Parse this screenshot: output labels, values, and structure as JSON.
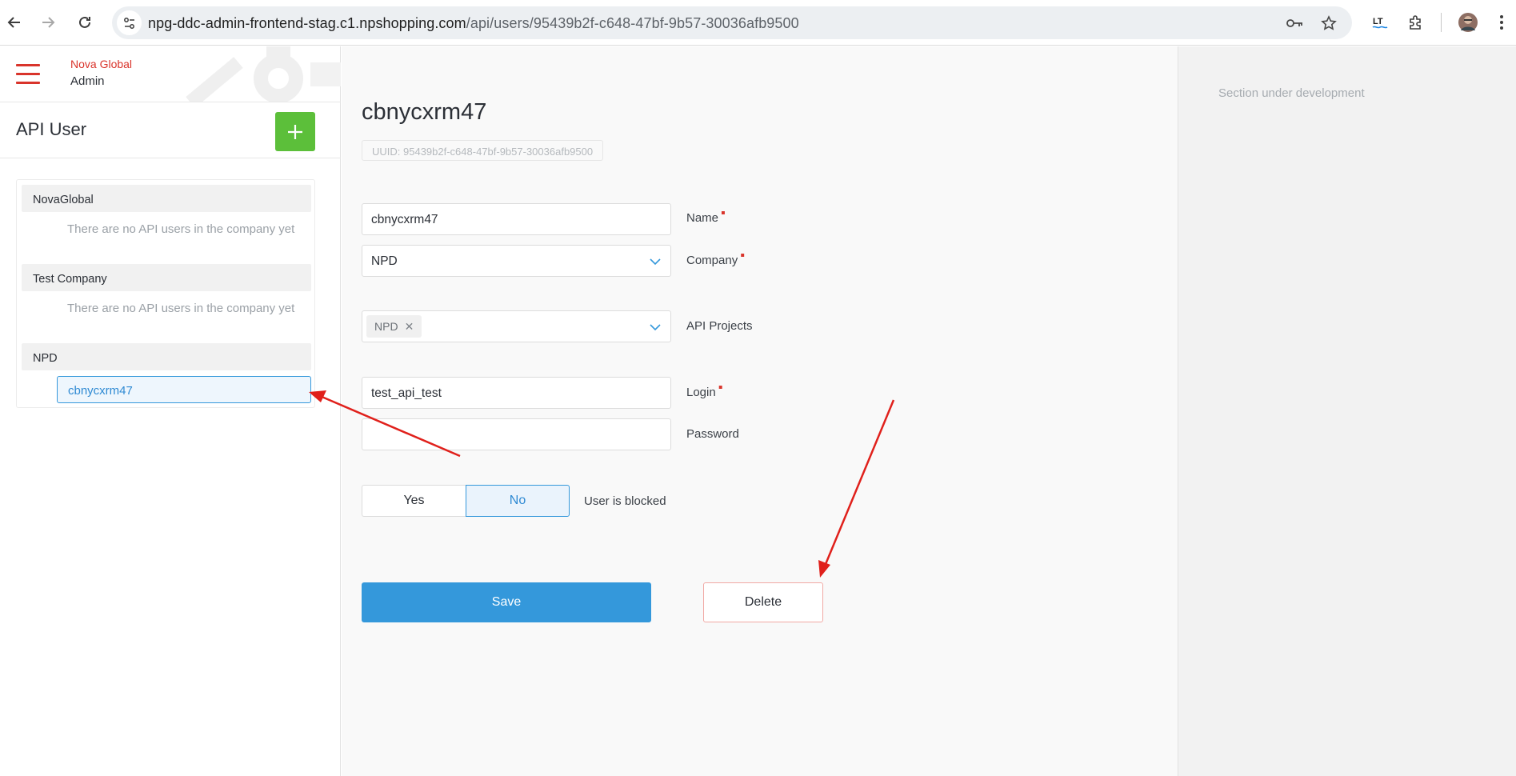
{
  "browser": {
    "url_host": "npg-ddc-admin-frontend-stag.c1.npshopping.com",
    "url_path": "/api/users/95439b2f-c648-47bf-9b57-30036afb9500",
    "ext_label": "LT"
  },
  "brand": {
    "name": "Nova Global",
    "subtitle": "Admin"
  },
  "sidebar": {
    "title": "API User",
    "add_label": "+",
    "groups": [
      {
        "name": "NovaGlobal",
        "empty_text": "There are no API users in the company yet"
      },
      {
        "name": "Test Company",
        "empty_text": "There are no API users in the company yet"
      },
      {
        "name": "NPD",
        "users": [
          "cbnycxrm47"
        ]
      }
    ]
  },
  "form": {
    "title": "cbnycxrm47",
    "uuid": "UUID: 95439b2f-c648-47bf-9b57-30036afb9500",
    "name_value": "cbnycxrm47",
    "name_label": "Name",
    "company_value": "NPD",
    "company_label": "Company",
    "projects_tags": [
      "NPD"
    ],
    "projects_label": "API Projects",
    "login_value": "test_api_test",
    "login_label": "Login",
    "password_value": "",
    "password_label": "Password",
    "blocked_yes": "Yes",
    "blocked_no": "No",
    "blocked_label": "User is blocked",
    "blocked_selected": "No",
    "save_label": "Save",
    "delete_label": "Delete"
  },
  "right_panel": {
    "note": "Section under development"
  },
  "colors": {
    "accent": "#3498db",
    "brand_red": "#d9342b",
    "add_green": "#5cbf3a",
    "annotation_arrow": "#e0201b"
  }
}
